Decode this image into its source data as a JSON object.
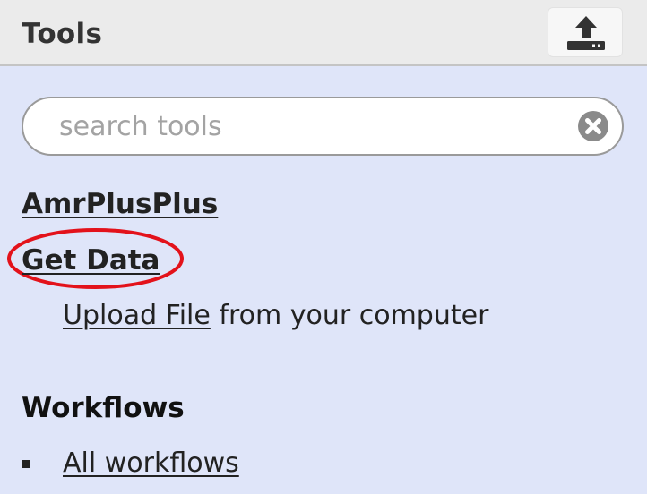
{
  "header": {
    "title": "Tools",
    "upload_icon": "upload-icon"
  },
  "search": {
    "placeholder": "search tools",
    "value": "",
    "clear_icon": "clear-circle-x-icon"
  },
  "sections": [
    {
      "label": "AmrPlusPlus"
    },
    {
      "label": "Get Data",
      "highlighted": true,
      "highlight_color": "#e3121b",
      "tools": [
        {
          "link_label": "Upload File",
          "description": " from your computer"
        }
      ]
    }
  ],
  "workflows": {
    "title": "Workflows",
    "items": [
      {
        "label": "All workflows"
      }
    ]
  },
  "colors": {
    "panel_background": "#dfe5f9",
    "header_background": "#ebebeb",
    "text": "#222222"
  }
}
